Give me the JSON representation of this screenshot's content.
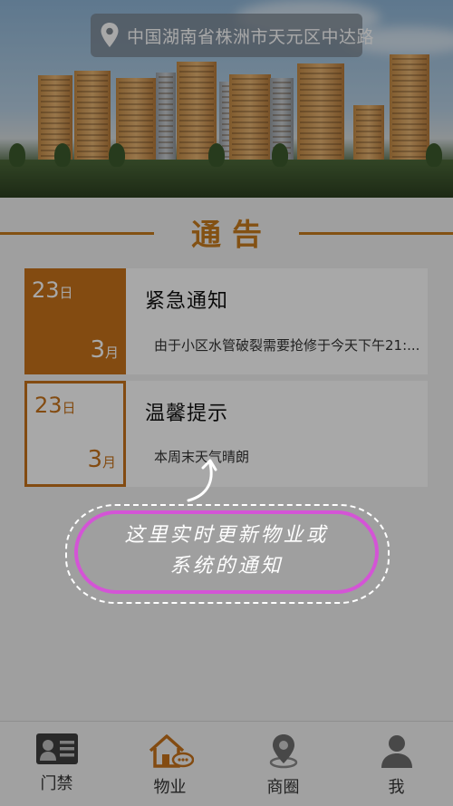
{
  "header": {
    "location": "中国湖南省株洲市天元区中达路",
    "location_icon": "map-pin-icon"
  },
  "notice": {
    "title": "通告",
    "items": [
      {
        "day": "23",
        "day_unit": "日",
        "month": "3",
        "month_unit": "月",
        "title": "紧急通知",
        "body": "由于小区水管破裂需要抢修于今天下午21:..."
      },
      {
        "day": "23",
        "day_unit": "日",
        "month": "3",
        "month_unit": "月",
        "title": "温馨提示",
        "body": "本周末天气晴朗"
      }
    ]
  },
  "tutorial": {
    "line1": "这里实时更新物业或",
    "line2": "系统的通知"
  },
  "bottom_nav": {
    "items": [
      {
        "label": "门禁",
        "icon": "id-card-icon"
      },
      {
        "label": "物业",
        "icon": "house-icon"
      },
      {
        "label": "商圈",
        "icon": "map-pin-icon"
      },
      {
        "label": "我",
        "icon": "user-icon"
      }
    ],
    "active_index": 1
  },
  "colors": {
    "accent": "#c7731b",
    "highlight_ring": "#d454d6"
  }
}
